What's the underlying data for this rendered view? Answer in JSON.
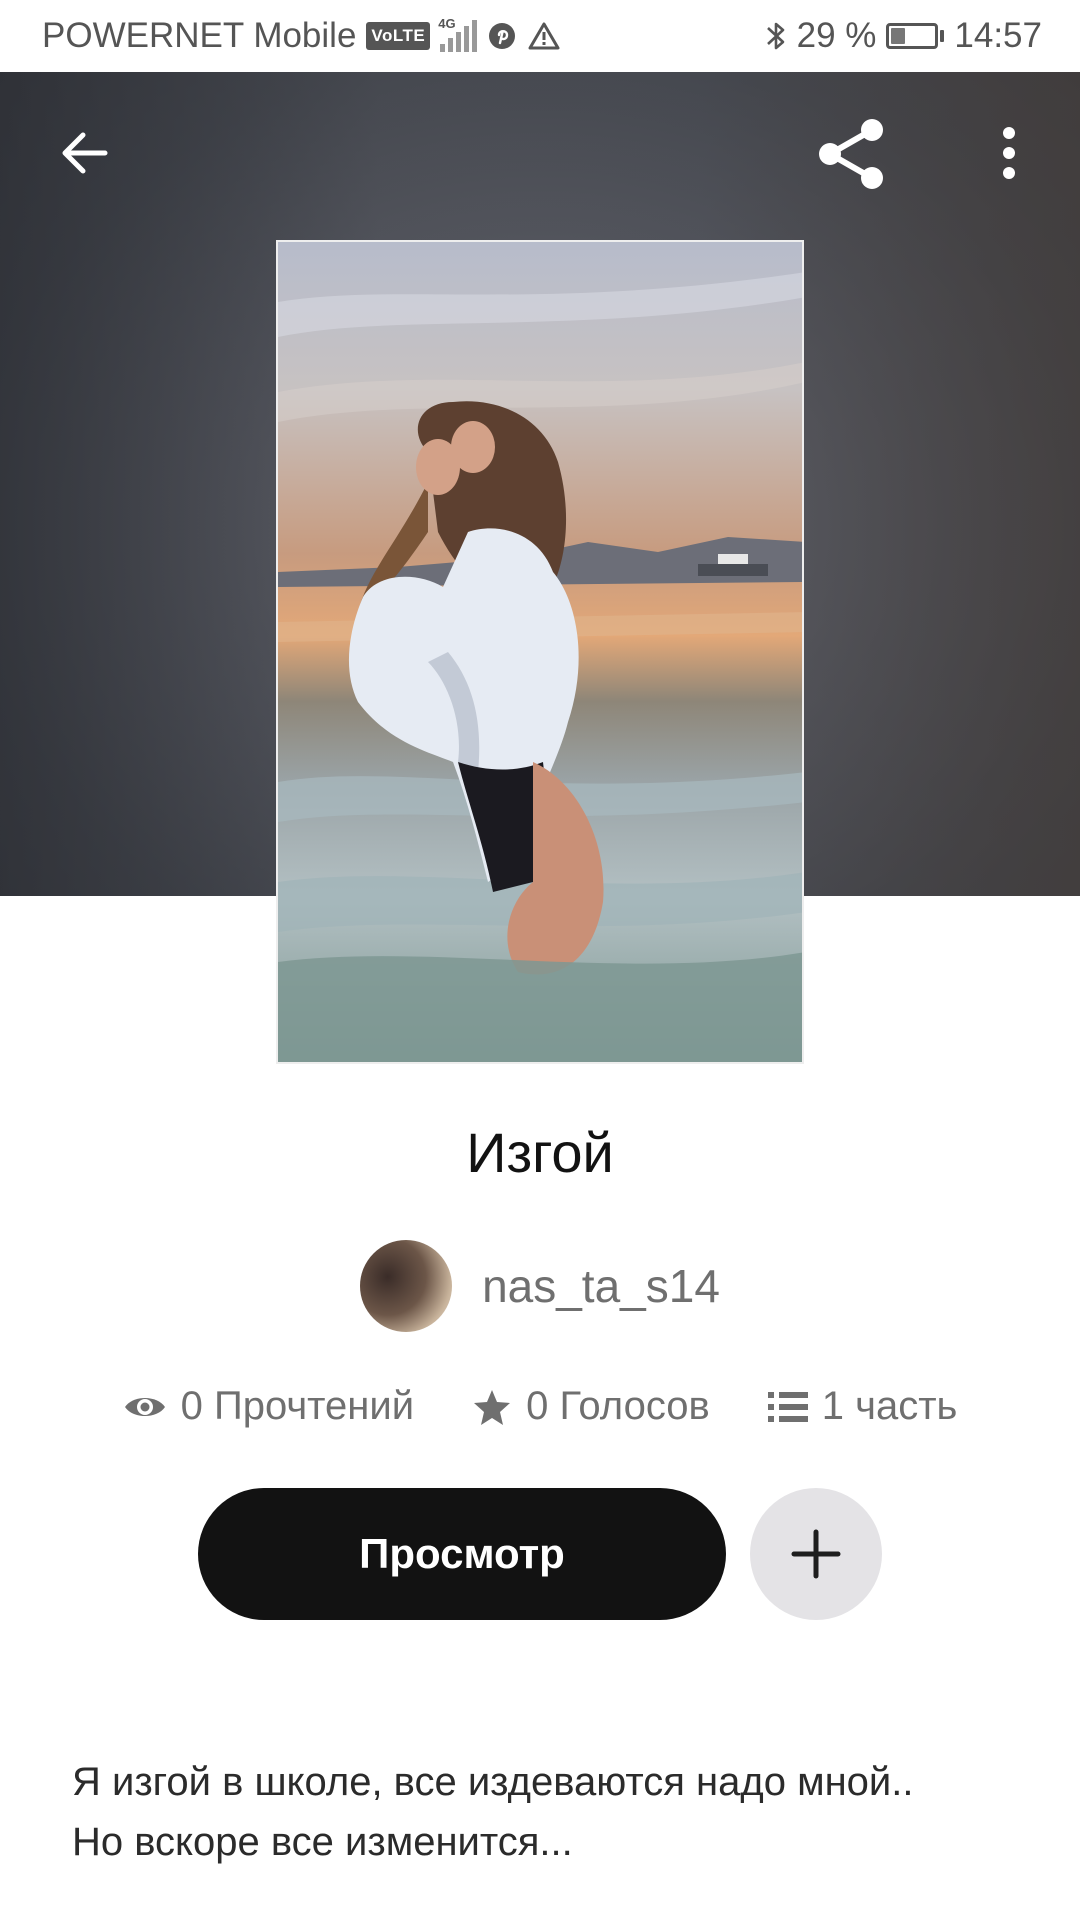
{
  "status_bar": {
    "carrier": "POWERNET Mobile",
    "volte": "VoLTE",
    "network": "4G",
    "battery_percent": "29 %",
    "battery_level": 0.29,
    "time": "14:57",
    "icons": [
      "volte-icon",
      "signal-icon",
      "pinterest-icon",
      "warning-icon",
      "bluetooth-icon",
      "battery-icon"
    ]
  },
  "toolbar": {
    "back_icon": "arrow-left-icon",
    "share_icon": "share-icon",
    "more_icon": "more-vertical-icon"
  },
  "story": {
    "title": "Изгой",
    "author": "nas_ta_s14",
    "stats": {
      "reads": "0 Прочтений",
      "votes": "0 Голосов",
      "parts": "1 часть"
    },
    "read_button": "Просмотр",
    "add_icon": "plus-icon",
    "description": [
      "Я изгой в школе, все издеваются надо мной..",
      "Но вскоре все изменится..."
    ]
  },
  "colors": {
    "primary_button": "#121212",
    "secondary_button": "#e4e3e6",
    "muted_text": "#6f6f6f"
  }
}
